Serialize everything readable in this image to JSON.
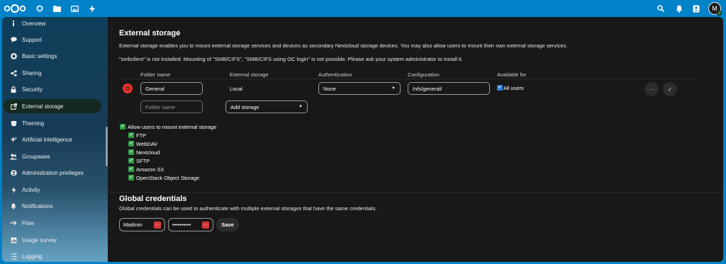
{
  "header": {
    "logo_icon": "nextcloud-logo",
    "apps": [
      {
        "name": "dashboard-icon"
      },
      {
        "name": "files-icon"
      },
      {
        "name": "photos-icon"
      },
      {
        "name": "activity-icon"
      }
    ],
    "right_icons": [
      "search-icon",
      "notifications-icon",
      "contacts-icon"
    ],
    "avatar_initial": "M"
  },
  "sidebar": {
    "items": [
      {
        "label": "Overview",
        "icon": "info-icon"
      },
      {
        "label": "Support",
        "icon": "support-icon"
      },
      {
        "label": "Basic settings",
        "icon": "settings-icon"
      },
      {
        "label": "Sharing",
        "icon": "share-icon"
      },
      {
        "label": "Security",
        "icon": "lock-icon"
      },
      {
        "label": "External storage",
        "icon": "external-storage-icon",
        "active": true
      },
      {
        "label": "Theming",
        "icon": "theming-icon"
      },
      {
        "label": "Artificial Intelligence",
        "icon": "ai-icon"
      },
      {
        "label": "Groupware",
        "icon": "groupware-icon"
      },
      {
        "label": "Administration privileges",
        "icon": "admin-icon"
      },
      {
        "label": "Activity",
        "icon": "activity-icon"
      },
      {
        "label": "Notifications",
        "icon": "bell-icon"
      },
      {
        "label": "Flow",
        "icon": "flow-icon"
      },
      {
        "label": "Usage survey",
        "icon": "survey-icon"
      },
      {
        "label": "Logging",
        "icon": "logging-icon"
      }
    ]
  },
  "external_storage": {
    "title": "External storage",
    "description": "External storage enables you to mount external storage services and devices as secondary Nextcloud storage devices. You may also allow users to mount their own external storage services.",
    "warning": "\"smbclient\" is not installed. Mounting of \"SMB/CIFS\", \"SMB/CIFS using OC login\" is not possible. Please ask your system administrator to install it.",
    "columns": {
      "folder_name": "Folder name",
      "external_storage": "External storage",
      "authentication": "Authentication",
      "configuration": "Configuration",
      "available_for": "Available for"
    },
    "mount": {
      "folder_name": "General",
      "backend": "Local",
      "authentication": "None",
      "configuration": "/nfs/general/",
      "available_for": "All users"
    },
    "new_mount": {
      "folder_placeholder": "Folder name",
      "add_storage": "Add storage"
    },
    "allow_users_label": "Allow users to mount external storage",
    "backends": [
      "FTP",
      "WebDAV",
      "Nextcloud",
      "SFTP",
      "Amazon S3",
      "OpenStack Object Storage"
    ]
  },
  "global_credentials": {
    "title": "Global credentials",
    "description": "Global credentials can be used to authenticate with multiple external storages that have the same credentials.",
    "username": "Madmin",
    "password_mask": "••••••••••",
    "save_label": "Save"
  },
  "colors": {
    "header_blue": "#0082c9",
    "main_bg": "#181818",
    "checkbox_green": "#2fa044",
    "status_red": "#e9322d"
  }
}
